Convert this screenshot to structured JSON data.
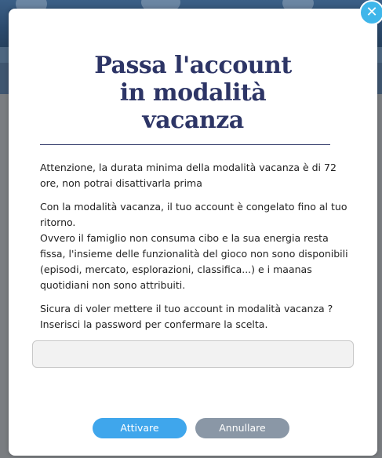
{
  "modal": {
    "close_icon": "close-icon",
    "close_glyph": "✕",
    "title_lines": [
      "Passa l'account",
      "in modalità",
      "vacanza"
    ],
    "paragraphs": [
      "Attenzione, la durata minima della modalità vacanza è di 72 ore, non potrai disattivarla prima",
      "Con la modalità vacanza, il tuo account è congelato fino al tuo ritorno.",
      "Ovvero il famiglio non consuma cibo e la sua energia resta fissa, l'insieme delle funzionalità del gioco non sono disponibili (episodi, mercato, esplorazioni, classifica...) e i maanas quotidiani non sono attribuiti.",
      "Sicura di voler mettere il tuo account in modalità vacanza ? Inserisci la password per confermare la scelta."
    ],
    "password_value": "",
    "activate_label": "Attivare",
    "cancel_label": "Annullare"
  },
  "colors": {
    "title": "#2d3566",
    "activate_button": "#3fa6ec",
    "cancel_button": "#8a97a6",
    "close_button": "#3fb6ea"
  }
}
